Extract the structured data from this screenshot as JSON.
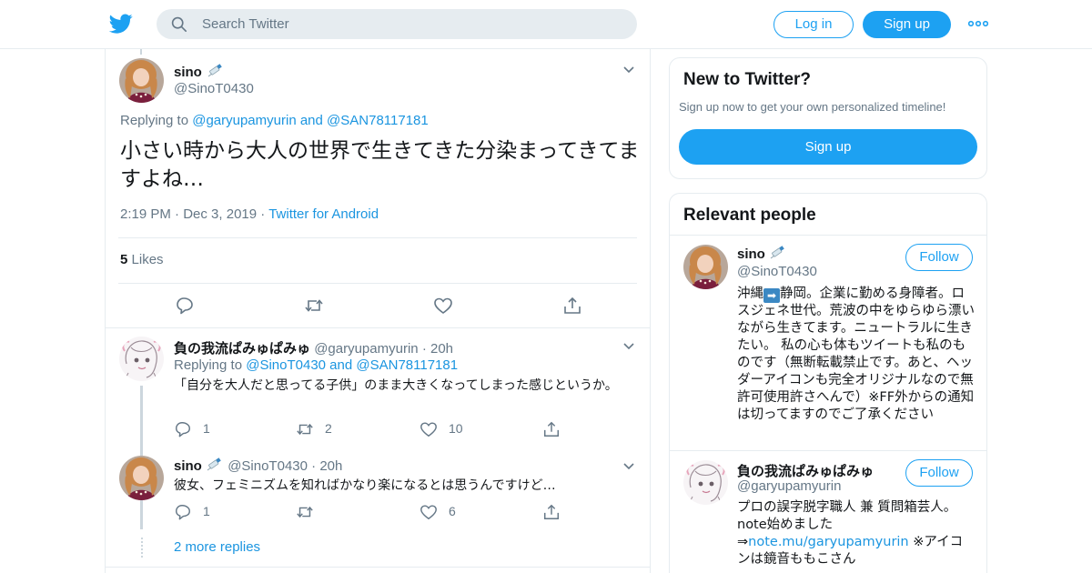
{
  "header": {
    "search_placeholder": "Search Twitter",
    "login_label": "Log in",
    "signup_label": "Sign up"
  },
  "main_tweet": {
    "name": "sino",
    "handle": "@SinoT0430",
    "replying_prefix": "Replying to",
    "replying_to_1": "@garyupamyurin",
    "replying_and": "and",
    "replying_to_2": "@SAN78117181",
    "text": "小さい時から大人の世界で生きてきた分染まってきてますよね…",
    "time": "2:19 PM",
    "date": "Dec 3, 2019",
    "source": "Twitter for Android",
    "likes_count": "5",
    "likes_label": "Likes"
  },
  "replies": [
    {
      "name": "負の我流ぱみゅぱみゅ",
      "handle": "@garyupamyurin",
      "time": "20h",
      "replying_prefix": "Replying to",
      "replying_to_1": "@SinoT0430",
      "replying_and": "and",
      "replying_to_2": "@SAN78117181",
      "text": "「自分を大人だと思ってる子供」のまま大きくなってしまった感じというか。",
      "reply_count": "1",
      "retweet_count": "2",
      "like_count": "10"
    },
    {
      "name": "sino",
      "handle": "@SinoT0430",
      "time": "20h",
      "text": "彼女、フェミニズムを知ればかなり楽になるとは思うんですけど…",
      "reply_count": "1",
      "retweet_count": "",
      "like_count": "6"
    }
  ],
  "more_replies_label": "2 more replies",
  "sidebar": {
    "new_title": "New to Twitter?",
    "new_subtitle": "Sign up now to get your own personalized timeline!",
    "signup_label": "Sign up",
    "relevant_title": "Relevant people",
    "people": [
      {
        "name": "sino",
        "handle": "@SinoT0430",
        "follow_label": "Follow",
        "bio_before_flag": "沖縄",
        "bio_after_flag": "静岡。企業に勤める身障者。ロスジェネ世代。荒波の中をゆらゆら漂いながら生きてます。ニュートラルに生きたい。 私の心も体もツイートも私のものです（無断転載禁止です。あと、ヘッダーアイコンも完全オリジナルなので無許可使用許さへんで）※FF外からの通知は切ってますのでご了承ください"
      },
      {
        "name": "負の我流ぱみゅぱみゅ",
        "handle": "@garyupamyurin",
        "follow_label": "Follow",
        "bio_line1": "プロの誤字脱字職人 兼 質問箱芸人。",
        "bio_line2": "note始めました",
        "bio_arrow": "⇒",
        "bio_link": "note.mu/garyupamyurin",
        "bio_tail": " ※アイコンは鏡音ももこさん"
      }
    ]
  },
  "colors": {
    "accent": "#1da1f2",
    "link": "#1b95e0",
    "muted": "#657786",
    "divider": "#e6ecf0"
  }
}
